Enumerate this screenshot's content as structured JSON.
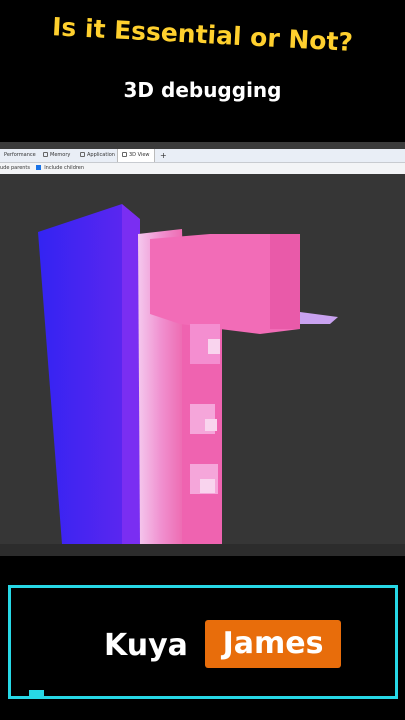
{
  "video": {
    "headline": "Is it Essential or Not?",
    "subheadline": "3D debugging"
  },
  "devtools": {
    "tabs": [
      {
        "label": "Performance",
        "active": false
      },
      {
        "label": "Memory",
        "active": false
      },
      {
        "label": "Application",
        "active": false
      },
      {
        "label": "3D View",
        "active": true
      }
    ],
    "new_tab_symbol": "+",
    "options": {
      "include_parents_label": "ude parents",
      "include_children_label": "Include children",
      "include_children_checked": true
    }
  },
  "branding": {
    "first_name": "Kuya",
    "last_name": "James",
    "accent_color": "#e86d0b",
    "frame_color": "#27d8e6"
  }
}
